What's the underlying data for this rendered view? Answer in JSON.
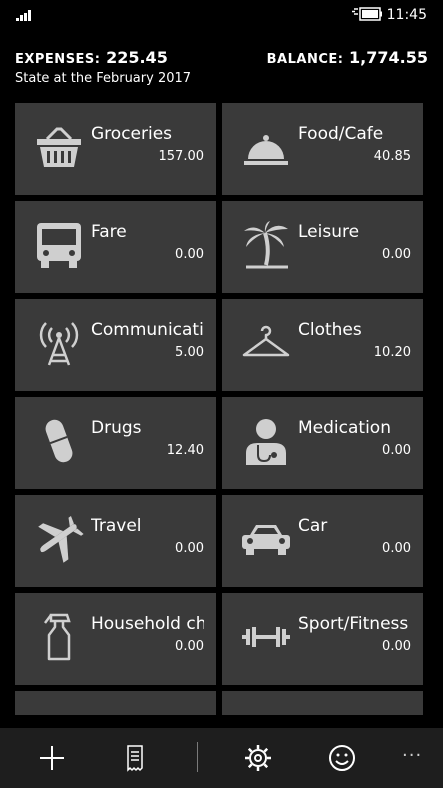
{
  "status_bar": {
    "time": "11:45"
  },
  "summary": {
    "expenses_label": "EXPENSES:",
    "expenses_value": "225.45",
    "balance_label": "BALANCE:",
    "balance_value": "1,774.55",
    "state_text": "State at the February 2017"
  },
  "categories": [
    {
      "name": "Groceries",
      "amount": "157.00",
      "icon": "basket-icon"
    },
    {
      "name": "Food/Cafe",
      "amount": "40.85",
      "icon": "cloche-icon"
    },
    {
      "name": "Fare",
      "amount": "0.00",
      "icon": "bus-icon"
    },
    {
      "name": "Leisure",
      "amount": "0.00",
      "icon": "palm-tree-icon"
    },
    {
      "name": "Communications",
      "amount": "5.00",
      "icon": "antenna-icon"
    },
    {
      "name": "Clothes",
      "amount": "10.20",
      "icon": "hanger-icon"
    },
    {
      "name": "Drugs",
      "amount": "12.40",
      "icon": "pill-icon"
    },
    {
      "name": "Medication",
      "amount": "0.00",
      "icon": "doctor-icon"
    },
    {
      "name": "Travel",
      "amount": "0.00",
      "icon": "airplane-icon"
    },
    {
      "name": "Car",
      "amount": "0.00",
      "icon": "car-icon"
    },
    {
      "name": "Household chemicals",
      "amount": "0.00",
      "icon": "spray-bottle-icon"
    },
    {
      "name": "Sport/Fitness",
      "amount": "0.00",
      "icon": "dumbbell-icon"
    }
  ],
  "app_bar": {
    "buttons": [
      "add-icon",
      "receipt-icon",
      "settings-icon",
      "smiley-icon",
      "more-icon"
    ],
    "more_label": "···"
  },
  "colors": {
    "tile": "#3a3a3a",
    "icon": "#cfcfcf",
    "background": "#000000",
    "appbar": "#1e1e1e"
  }
}
